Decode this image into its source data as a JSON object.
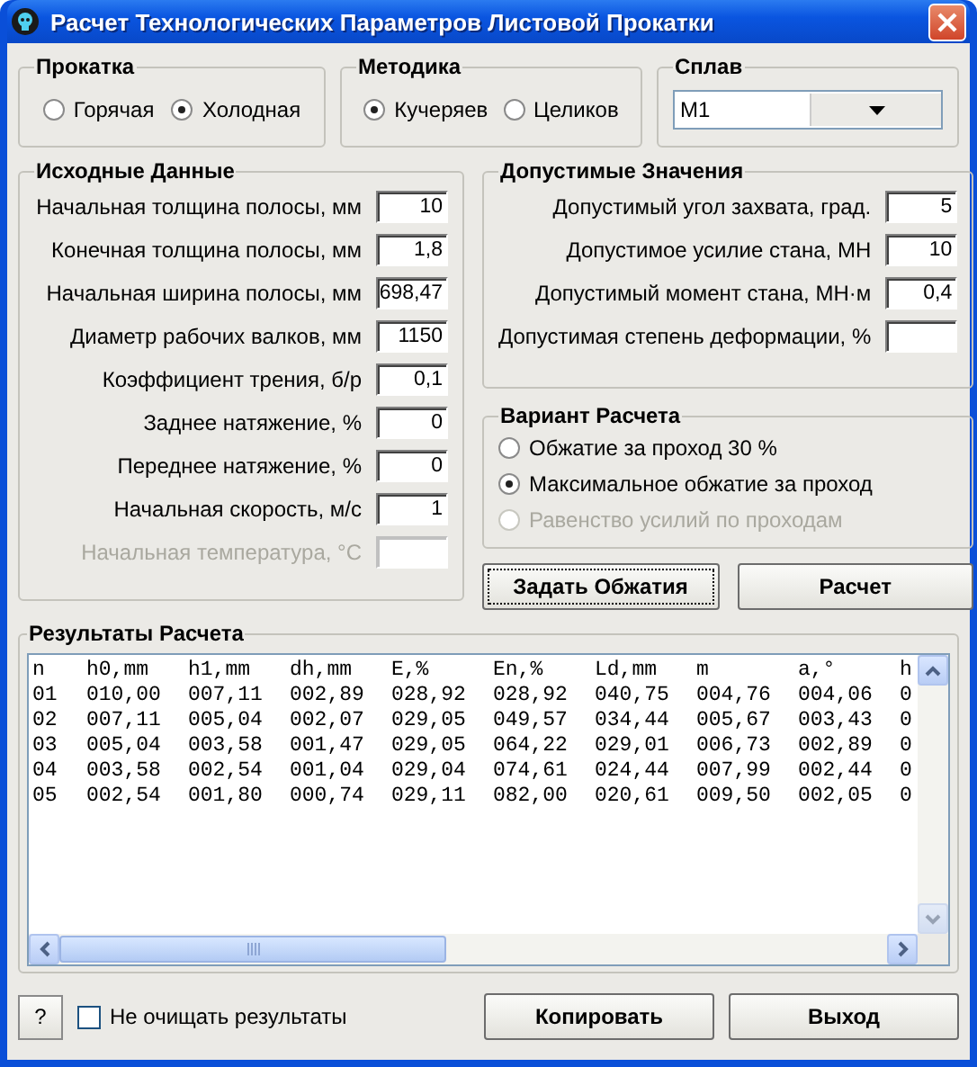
{
  "window": {
    "title": "Расчет Технологических Параметров Листовой Прокатки"
  },
  "rolling": {
    "title": "Прокатка",
    "options": [
      {
        "label": "Горячая",
        "selected": false
      },
      {
        "label": "Холодная",
        "selected": true
      }
    ]
  },
  "method": {
    "title": "Методика",
    "options": [
      {
        "label": "Кучеряев",
        "selected": true
      },
      {
        "label": "Целиков",
        "selected": false
      }
    ]
  },
  "alloy": {
    "title": "Сплав",
    "value": "М1"
  },
  "input_data": {
    "title": "Исходные Данные",
    "fields": [
      {
        "label": "Начальная толщина полосы, мм",
        "value": "10",
        "disabled": false
      },
      {
        "label": "Конечная толщина полосы, мм",
        "value": "1,8",
        "disabled": false
      },
      {
        "label": "Начальная ширина полосы, мм",
        "value": "698,47",
        "disabled": false
      },
      {
        "label": "Диаметр рабочих валков, мм",
        "value": "1150",
        "disabled": false
      },
      {
        "label": "Коэффициент трения, б/р",
        "value": "0,1",
        "disabled": false
      },
      {
        "label": "Заднее натяжение, %",
        "value": "0",
        "disabled": false
      },
      {
        "label": "Переднее натяжение, %",
        "value": "0",
        "disabled": false
      },
      {
        "label": "Начальная скорость, м/с",
        "value": "1",
        "disabled": false
      },
      {
        "label": "Начальная температура, °C",
        "disabled": true
      }
    ]
  },
  "limits": {
    "title": "Допустимые Значения",
    "fields": [
      {
        "label": "Допустимый угол захвата, град.",
        "value": "5",
        "disabled": false
      },
      {
        "label": "Допустимое усилие стана, МН",
        "value": "10",
        "disabled": false
      },
      {
        "label": "Допустимый момент стана, МН·м",
        "value": "0,4",
        "disabled": false
      },
      {
        "label": "Допустимая степень деформации, %",
        "disabled": false
      }
    ]
  },
  "variant": {
    "title": "Вариант Расчета",
    "options": [
      {
        "label": "Обжатие за проход 30 %",
        "selected": false,
        "disabled": false
      },
      {
        "label": "Максимальное обжатие за проход",
        "selected": true,
        "disabled": false
      },
      {
        "label": "Равенство усилий по проходам",
        "selected": false,
        "disabled": true
      }
    ]
  },
  "actions": [
    {
      "label": "Задать Обжатия",
      "focused": true
    },
    {
      "label": "Расчет",
      "focused": false
    }
  ],
  "results": {
    "title": "Результаты Расчета",
    "columns": [
      "n",
      "h0,mm",
      "h1,mm",
      "dh,mm",
      "E,%",
      "En,%",
      "Ld,mm",
      "m",
      "a,°",
      "h"
    ],
    "rows": [
      [
        "01",
        "010,00",
        "007,11",
        "002,89",
        "028,92",
        "028,92",
        "040,75",
        "004,76",
        "004,06",
        "0"
      ],
      [
        "02",
        "007,11",
        "005,04",
        "002,07",
        "029,05",
        "049,57",
        "034,44",
        "005,67",
        "003,43",
        "0"
      ],
      [
        "03",
        "005,04",
        "003,58",
        "001,47",
        "029,05",
        "064,22",
        "029,01",
        "006,73",
        "002,89",
        "0"
      ],
      [
        "04",
        "003,58",
        "002,54",
        "001,04",
        "029,04",
        "074,61",
        "024,44",
        "007,99",
        "002,44",
        "0"
      ],
      [
        "05",
        "002,54",
        "001,80",
        "000,74",
        "029,11",
        "082,00",
        "020,61",
        "009,50",
        "002,05",
        "0"
      ]
    ]
  },
  "help_button": {
    "label": "?"
  },
  "keep_results": {
    "label": "Не очищать результаты",
    "checked": false
  },
  "bottom_buttons": [
    "Копировать",
    "Выход"
  ]
}
